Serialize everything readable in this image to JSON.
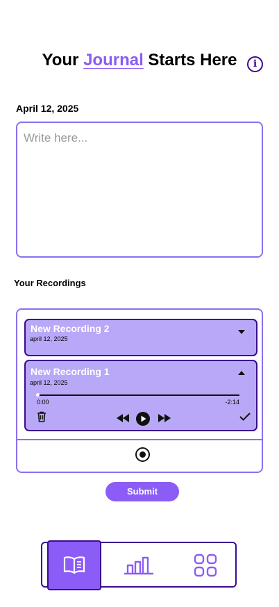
{
  "header": {
    "title_prefix": "Your ",
    "title_accent": "Journal",
    "title_suffix": " Starts Here",
    "info_glyph": "i"
  },
  "journal": {
    "date": "April 12, 2025",
    "placeholder": "Write here...",
    "value": ""
  },
  "recordings": {
    "heading": "Your Recordings",
    "items": [
      {
        "name": "New Recording 2",
        "date": "april 12, 2025",
        "expanded": false
      },
      {
        "name": "New Recording 1",
        "date": "april 12, 2025",
        "expanded": true,
        "elapsed": "0:00",
        "remaining": "-2:14",
        "progress": 0
      }
    ]
  },
  "actions": {
    "submit_label": "Submit"
  },
  "nav": {
    "items": [
      {
        "icon": "book-open-icon",
        "active": true
      },
      {
        "icon": "bar-chart-icon",
        "active": false
      },
      {
        "icon": "grid-icon",
        "active": false
      }
    ]
  },
  "colors": {
    "accent": "#8b5cf6",
    "dark": "#3b0a8f",
    "card": "#b9a8f7",
    "border": "#8b6ff0"
  }
}
